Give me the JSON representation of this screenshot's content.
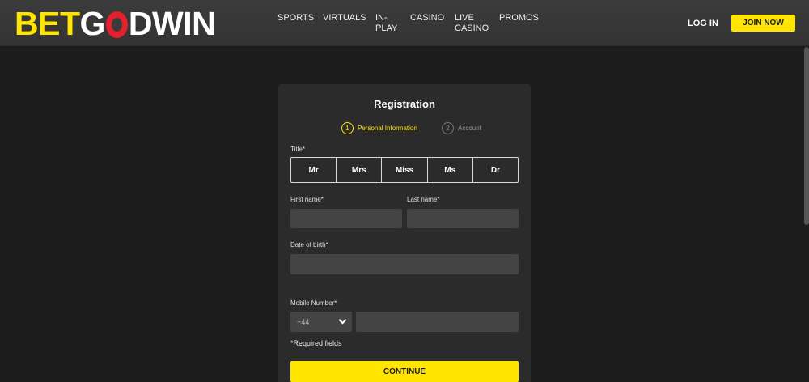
{
  "header": {
    "logo": {
      "part1": "BET",
      "part2": "G",
      "part3": "DWIN",
      "o_color": "#e4202e",
      "accent": "#ffe500"
    },
    "nav": [
      {
        "id": "sports",
        "lines": [
          "SPORTS"
        ]
      },
      {
        "id": "virtuals",
        "lines": [
          "VIRTUALS"
        ]
      },
      {
        "id": "in-play",
        "lines": [
          "IN-",
          "PLAY"
        ]
      },
      {
        "id": "casino",
        "lines": [
          "CASINO"
        ]
      },
      {
        "id": "live-casino",
        "lines": [
          "LIVE",
          "CASINO"
        ]
      },
      {
        "id": "promos",
        "lines": [
          "PROMOS"
        ]
      }
    ],
    "login_label": "LOG IN",
    "join_label": "JOIN NOW"
  },
  "form": {
    "title": "Registration",
    "steps": [
      {
        "num": "1",
        "label": "Personal Information",
        "active": true
      },
      {
        "num": "2",
        "label": "Account",
        "active": false
      }
    ],
    "title_label": "Title*",
    "title_options": [
      "Mr",
      "Mrs",
      "Miss",
      "Ms",
      "Dr"
    ],
    "first_name_label": "First name*",
    "first_name_value": "",
    "last_name_label": "Last name*",
    "last_name_value": "",
    "dob_label": "Date of birth*",
    "dob_value": "",
    "mobile_label": "Mobile Number*",
    "country_code": "+44",
    "mobile_value": "",
    "required_note": "*Required fields",
    "continue_label": "CONTINUE"
  }
}
